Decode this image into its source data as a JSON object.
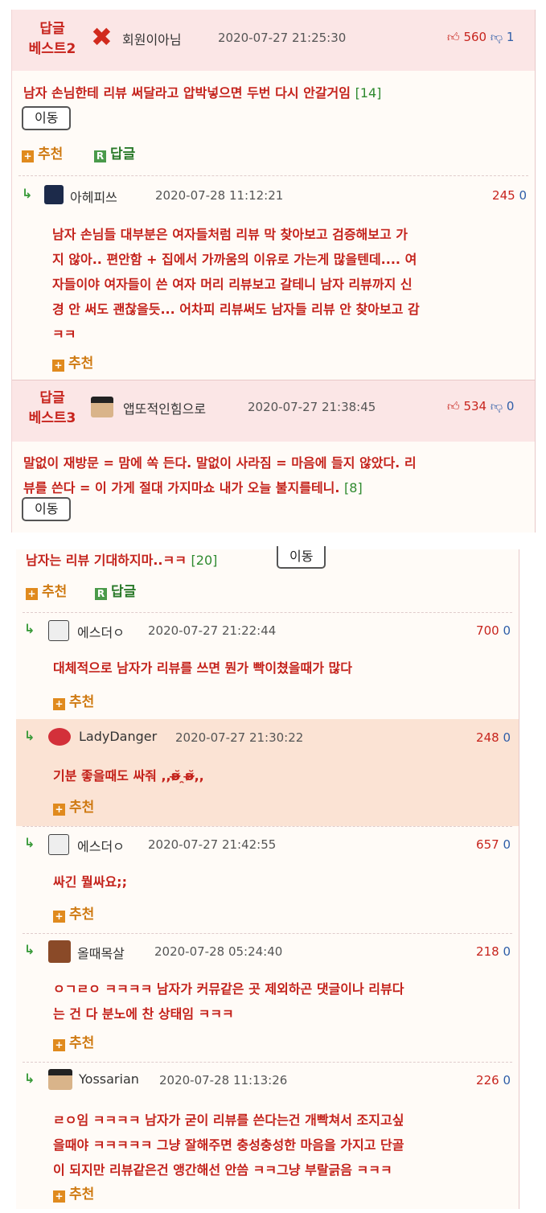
{
  "best2": {
    "label_line1": "답글",
    "label_line2": "베스트2",
    "nick": "회원이아님",
    "date": "2020-07-27 21:25:30",
    "up": "560",
    "down": "1",
    "body": "남자 손님한테 리뷰 써달라고 압박넣으면 두번 다시 안갈거임",
    "count": "[14]",
    "move": "이동",
    "recommend": "추천",
    "reply": "답글"
  },
  "reply_a": {
    "nick": "아헤피쓰",
    "date": "2020-07-28 11:12:21",
    "score": "245",
    "zero": "0",
    "lines": [
      "남자 손님들 대부분은 여자들처럼 리뷰 막 찾아보고 검증해보고 가",
      "지 않아.. 편안함 + 집에서 가까움의 이유로 가는게 많을텐데.... 여",
      "자들이야 여자들이 쓴 여자 머리 리뷰보고 갈테니 남자 리뷰까지 신",
      "경 안 써도 괜찮을듯... 어차피 리뷰써도 남자들 리뷰 안 찾아보고 감",
      "ㅋㅋ"
    ],
    "recommend": "추천"
  },
  "best3": {
    "label_line1": "답글",
    "label_line2": "베스트3",
    "nick": "앱또적인힘으로",
    "date": "2020-07-27 21:38:45",
    "up": "534",
    "down": "0",
    "line1": "말없이 재방문 = 맘에 쏙 든다. 말없이 사라짐 = 마음에 들지 않았다. 리",
    "line2": "뷰를 쓴다 = 이 가게 절대 가지마쇼 내가 오늘 불지를테니.",
    "count": "[8]",
    "move": "이동"
  },
  "panel2_top": {
    "body": "남자는 리뷰 기대하지마..ㅋㅋ",
    "count": "[20]",
    "move": "이동",
    "recommend": "추천",
    "reply": "답글"
  },
  "replies": [
    {
      "nick": "에스더ㅇ",
      "date": "2020-07-27 21:22:44",
      "score": "700",
      "zero": "0",
      "lines": [
        "대체적으로 남자가 리뷰를 쓰면 뭔가 빡이쳤을때가 많다"
      ],
      "recommend": "추천"
    },
    {
      "nick": "LadyDanger",
      "date": "2020-07-27 21:30:22",
      "score": "248",
      "zero": "0",
      "lines": [
        "기분 좋을때도 싸줘 ,,ʚ̴̶̷̆ ̯ʚ̴̶̷̆,,"
      ],
      "recommend": "추천"
    },
    {
      "nick": "에스더ㅇ",
      "date": "2020-07-27 21:42:55",
      "score": "657",
      "zero": "0",
      "lines": [
        "싸긴 뭘싸요;;"
      ],
      "recommend": "추천"
    },
    {
      "nick": "올때목살",
      "date": "2020-07-28 05:24:40",
      "score": "218",
      "zero": "0",
      "lines": [
        "ㅇㄱㄹㅇ ㅋㅋㅋㅋ 남자가 커뮤같은 곳 제외하곤 댓글이나 리뷰다",
        "는 건 다 분노에 찬 상태임 ㅋㅋㅋ"
      ],
      "recommend": "추천"
    },
    {
      "nick": "Yossarian",
      "date": "2020-07-28 11:13:26",
      "score": "226",
      "zero": "0",
      "lines": [
        "ㄹㅇ임 ㅋㅋㅋㅋ 남자가 굳이 리뷰를 쓴다는건 개빡쳐서 조지고싶",
        "을때야 ㅋㅋㅋㅋㅋ 그냥 잘해주면 충성충성한 마음을 가지고 단골",
        "이 되지만 리뷰같은건 앵간해선 안씀 ㅋㅋ그냥 부랄긁음 ㅋㅋㅋ"
      ],
      "recommend": "추천"
    }
  ],
  "colors": {
    "accent_red": "#c4221b",
    "best_bg": "#fbe6e6",
    "highlight_bg": "#fbe3d4"
  }
}
